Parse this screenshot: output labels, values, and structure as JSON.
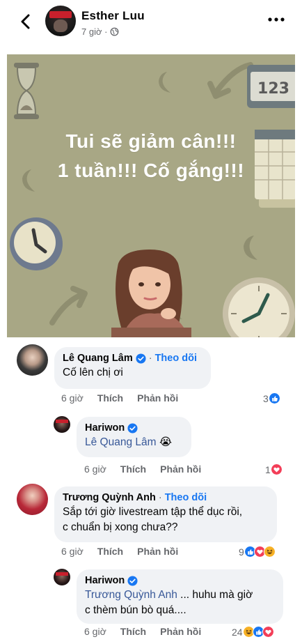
{
  "header": {
    "author": "Esther Luu",
    "time": "7 giờ ·"
  },
  "post": {
    "text_line1": "Tui sẽ giảm cân!!!",
    "text_line2": "1 tuần!!! Cố gắng!!!",
    "counter_digits": "123"
  },
  "comments": [
    {
      "name": "Lê Quang Lâm",
      "verified": true,
      "follow": "Theo dõi",
      "text": "Cố lên chị ơi",
      "time": "6 giờ",
      "like": "Thích",
      "reply": "Phản hồi",
      "reaction_count": "3"
    },
    {
      "name": "Hariwon",
      "verified": true,
      "mention": "Lê Quang Lâm",
      "emoji": "😭",
      "time": "6 giờ",
      "like": "Thích",
      "reply": "Phản hồi",
      "reaction_count": "1"
    },
    {
      "name": "Trương Quỳnh Anh",
      "follow": "Theo dõi",
      "text_line1": "Sắp tới giờ livestream tập thể dục rồi,",
      "text_line2": "c chuẩn bị xong chưa??",
      "time": "6 giờ",
      "like": "Thích",
      "reply": "Phản hồi",
      "reaction_count": "9"
    },
    {
      "name": "Hariwon",
      "verified": true,
      "mention": "Trương Quỳnh Anh",
      "text_after_mention": " ... huhu mà giờ",
      "text_line2": "c thèm bún bò quá....",
      "time": "6 giờ",
      "like": "Thích",
      "reply": "Phản hồi",
      "reaction_count": "24"
    }
  ],
  "colors": {
    "accent": "#1877f2",
    "bubble": "#f0f2f5",
    "secondary_text": "#65676b",
    "image_bg": "#a8a785",
    "love": "#f33e58",
    "haha": "#f7b125"
  }
}
